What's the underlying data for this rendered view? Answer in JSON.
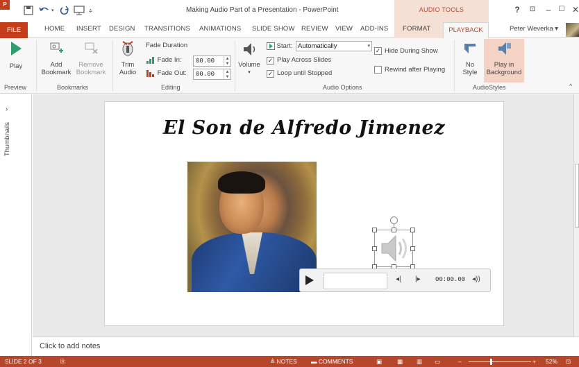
{
  "window": {
    "title": "Making Audio Part of a Presentation - PowerPoint",
    "tools_context": "AUDIO TOOLS",
    "app_icon": "P"
  },
  "tabs": [
    "HOME",
    "INSERT",
    "DESIGN",
    "TRANSITIONS",
    "ANIMATIONS",
    "SLIDE SHOW",
    "REVIEW",
    "VIEW",
    "ADD-INS",
    "FORMAT"
  ],
  "file_tab": "FILE",
  "active_tab": "PLAYBACK",
  "user": "Peter Weverka",
  "ribbon": {
    "play": "Play",
    "add_bookmark": [
      "Add",
      "Bookmark"
    ],
    "remove_bookmark": [
      "Remove",
      "Bookmark"
    ],
    "trim_audio": [
      "Trim",
      "Audio"
    ],
    "fade_duration": "Fade Duration",
    "fade_in_label": "Fade In:",
    "fade_in_value": "00.00",
    "fade_out_label": "Fade Out:",
    "fade_out_value": "00.00",
    "volume": "Volume",
    "start_label": "Start:",
    "start_value": "Automatically",
    "play_across_slides": "Play Across Slides",
    "loop_until_stopped": "Loop until Stopped",
    "hide_during_show": "Hide During Show",
    "rewind_after_playing": "Rewind after Playing",
    "no_style": [
      "No",
      "Style"
    ],
    "play_in_background": [
      "Play in",
      "Background"
    ],
    "checked": {
      "play_across_slides": true,
      "loop_until_stopped": true,
      "hide_during_show": true,
      "rewind_after_playing": false
    },
    "groups": {
      "preview": "Preview",
      "bookmarks": "Bookmarks",
      "editing": "Editing",
      "audio_options": "Audio Options",
      "audio_styles": "AudioStyles"
    }
  },
  "thumbnails_label": "Thumbnails",
  "slide": {
    "title": "El Son de Alfredo Jimenez",
    "player_time": "00:00.00"
  },
  "notes_placeholder": "Click to add notes",
  "status": {
    "slide_info": "SLIDE 2 OF 3",
    "notes": "NOTES",
    "comments": "COMMENTS",
    "zoom": "52%"
  },
  "colors": {
    "accent": "#b7472a",
    "file_tab": "#c43e1c",
    "tools_banner": "#f5e0d6"
  }
}
